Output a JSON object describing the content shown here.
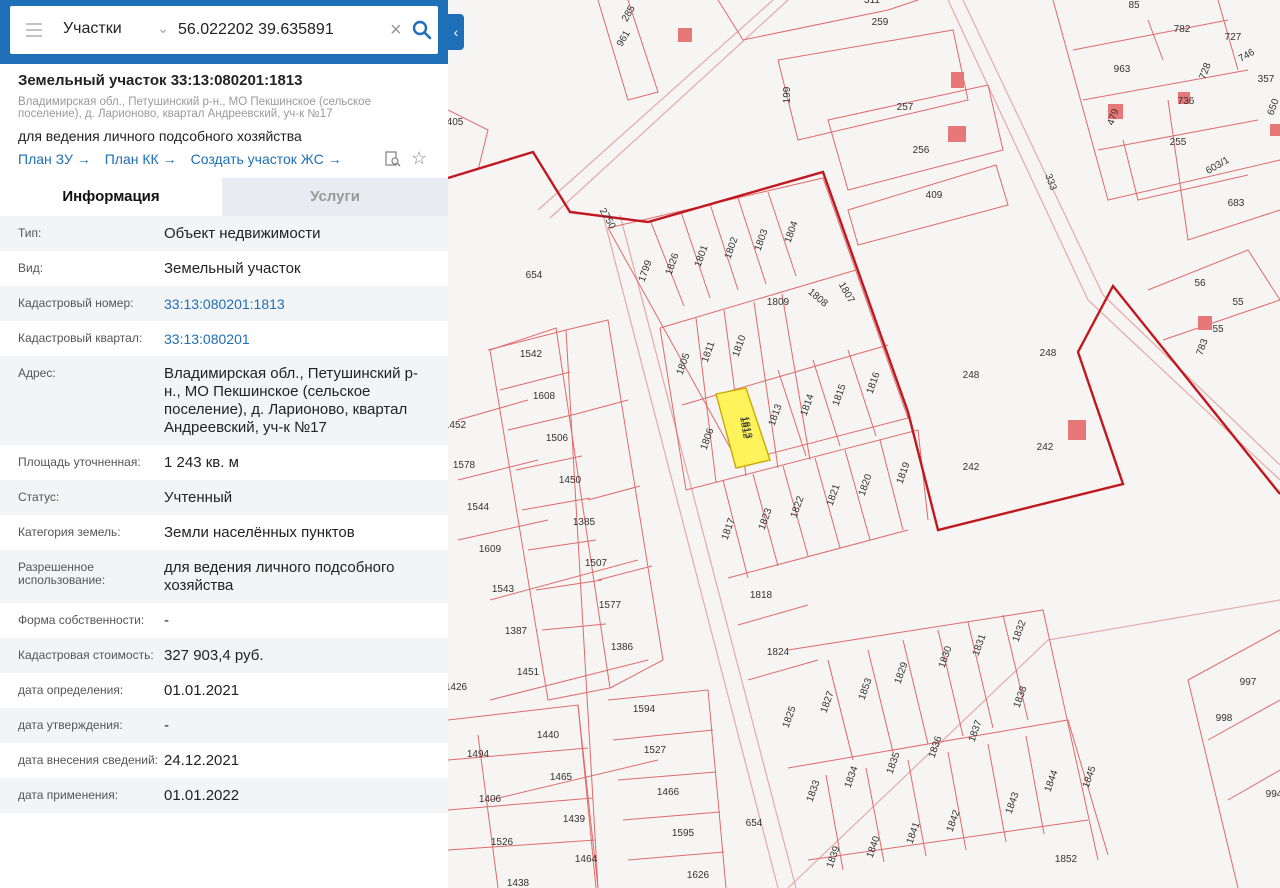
{
  "search": {
    "layer": "Участки",
    "query": "56.022202 39.635891"
  },
  "parcel": {
    "title": "Земельный участок 33:13:080201:1813",
    "address_small": "Владимирская обл., Петушинский р-н., МО Пекшинское (сельское поселение), д. Ларионово, квартал Андреевский, уч-к №17",
    "purpose": "для ведения личного подсобного хозяйства",
    "links": [
      "План ЗУ",
      "План КК",
      "Создать участок ЖС"
    ]
  },
  "tabs": [
    "Информация",
    "Услуги"
  ],
  "info": [
    {
      "k": "Тип:",
      "v": "Объект недвижимости"
    },
    {
      "k": "Вид:",
      "v": "Земельный участок"
    },
    {
      "k": "Кадастровый номер:",
      "v": "33:13:080201:1813"
    },
    {
      "k": "Кадастровый квартал:",
      "v": "33:13:080201"
    },
    {
      "k": "Адрес:",
      "v": "Владимирская обл., Петушинский р-н., МО Пекшинское (сельское поселение), д. Ларионово, квартал Андреевский, уч-к №17"
    },
    {
      "k": "Площадь уточненная:",
      "v": "1 243 кв. м"
    },
    {
      "k": "Статус:",
      "v": "Учтенный"
    },
    {
      "k": "Категория земель:",
      "v": "Земли населённых пунктов"
    },
    {
      "k": "Разрешенное использование:",
      "v": "для ведения личного подсобного хозяйства"
    },
    {
      "k": "Форма собственности:",
      "v": "-"
    },
    {
      "k": "Кадастровая стоимость:",
      "v": "327 903,4 руб."
    },
    {
      "k": "дата определения:",
      "v": "01.01.2021"
    },
    {
      "k": "дата утверждения:",
      "v": "-"
    },
    {
      "k": "дата внесения сведений:",
      "v": "24.12.2021"
    },
    {
      "k": "дата применения:",
      "v": "01.01.2022"
    }
  ],
  "map": {
    "colors": {
      "parcel_line": "#e06a6a",
      "block_line": "#c0181e",
      "selected_fill": "#fff35c",
      "building": "#e87878"
    },
    "parcel_labels": [
      "961",
      "285",
      "311",
      "259",
      "199",
      "257",
      "256",
      "409",
      "405",
      "2750",
      "654",
      "1799",
      "1826",
      "1801",
      "1802",
      "1803",
      "1804",
      "1805",
      "1811",
      "1810",
      "1809",
      "1808",
      "1807",
      "1806",
      "1812",
      "1813",
      "1814",
      "1815",
      "1816",
      "1817",
      "1823",
      "1822",
      "1821",
      "1820",
      "1819",
      "1818",
      "1824",
      "1825",
      "1827",
      "1853",
      "1829",
      "1830",
      "1831",
      "1832",
      "1838",
      "1833",
      "1834",
      "1835",
      "1836",
      "1837",
      "1843",
      "1844",
      "1845",
      "1839",
      "1840",
      "1841",
      "1842",
      "1852",
      "1542",
      "1608",
      "1506",
      "1450",
      "1385",
      "1507",
      "1577",
      "1386",
      "1452",
      "1578",
      "1544",
      "1609",
      "1543",
      "1387",
      "1451",
      "1426",
      "1594",
      "1527",
      "1466",
      "1595",
      "1626",
      "1440",
      "1465",
      "1439",
      "1464",
      "1494",
      "1406",
      "1526",
      "1438",
      "654",
      "248",
      "248",
      "242",
      "242",
      "85",
      "782",
      "727",
      "963",
      "728",
      "746",
      "736",
      "357",
      "479",
      "255",
      "650",
      "603/1",
      "683",
      "333",
      "56",
      "55",
      "55",
      "783",
      "997",
      "998",
      "994"
    ],
    "selected_parcel": "1813"
  }
}
